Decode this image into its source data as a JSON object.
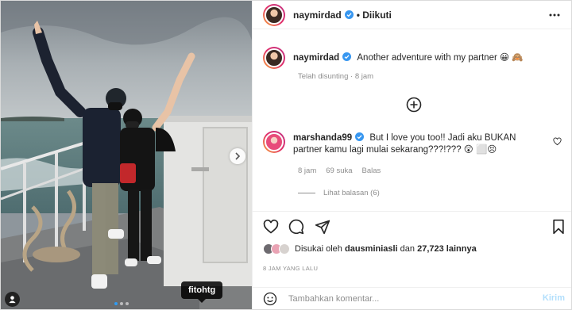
{
  "post": {
    "username": "naymirdad",
    "follow_label": "• Diikuti",
    "caption": "Another adventure with my partner 😀 🙈",
    "caption_time": "Telah disunting · 8 jam",
    "photo_tag": "fitohtg",
    "carousel_dots": 3
  },
  "comments": [
    {
      "username": "marshanda99",
      "text": "But I love you too!! Jadi aku BUKAN partner kamu lagi mulai sekarang???!??? 😲 ⬜😣",
      "time": "8 jam",
      "likes": "69 suka",
      "reply_label": "Balas",
      "view_replies": "Lihat balasan (6)"
    }
  ],
  "likes": {
    "prefix": "Disukai oleh ",
    "user": "dausminiasli",
    "middle": " dan ",
    "count": "27,723 lainnya"
  },
  "post_time": "8 JAM YANG LALU",
  "add_comment": {
    "placeholder": "Tambahkan komentar...",
    "post_label": "Kirim"
  },
  "colors": {
    "verified": "#3897f0",
    "link_disabled": "#b2dffc",
    "secondary_text": "#8e8e8e",
    "story_ring": "#e1306c"
  },
  "icons": [
    "more-icon",
    "plus-circle-icon",
    "heart-icon",
    "comment-icon",
    "share-icon",
    "bookmark-icon",
    "smile-icon",
    "user-tag-icon",
    "chevron-right-icon"
  ]
}
